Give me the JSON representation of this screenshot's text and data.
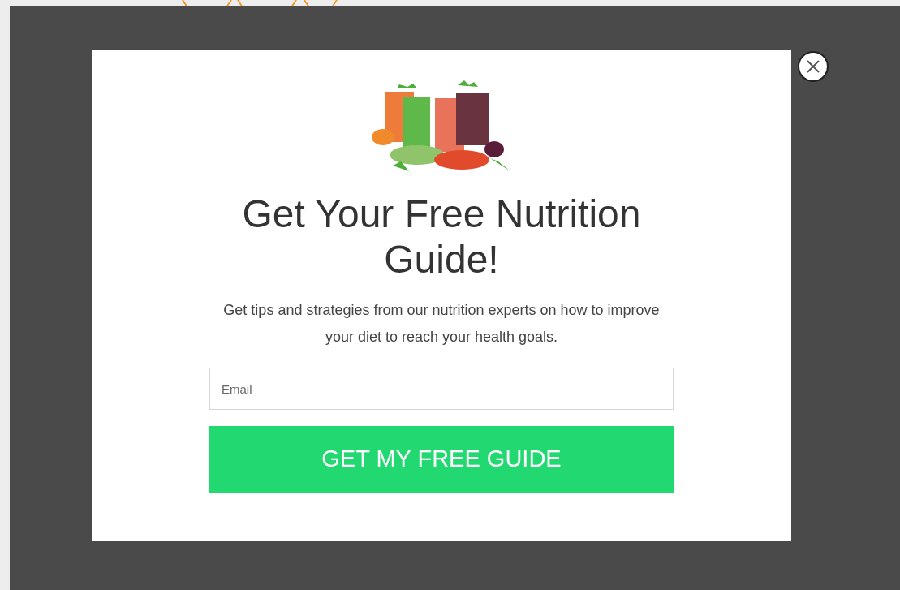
{
  "popup": {
    "heading": "Get Your Free Nutrition Guide!",
    "description": "Get tips and strategies from our nutrition experts on how to improve your diet to reach your health goals.",
    "email_field": {
      "placeholder": "Email"
    },
    "submit_button": "GET MY FREE GUIDE"
  }
}
